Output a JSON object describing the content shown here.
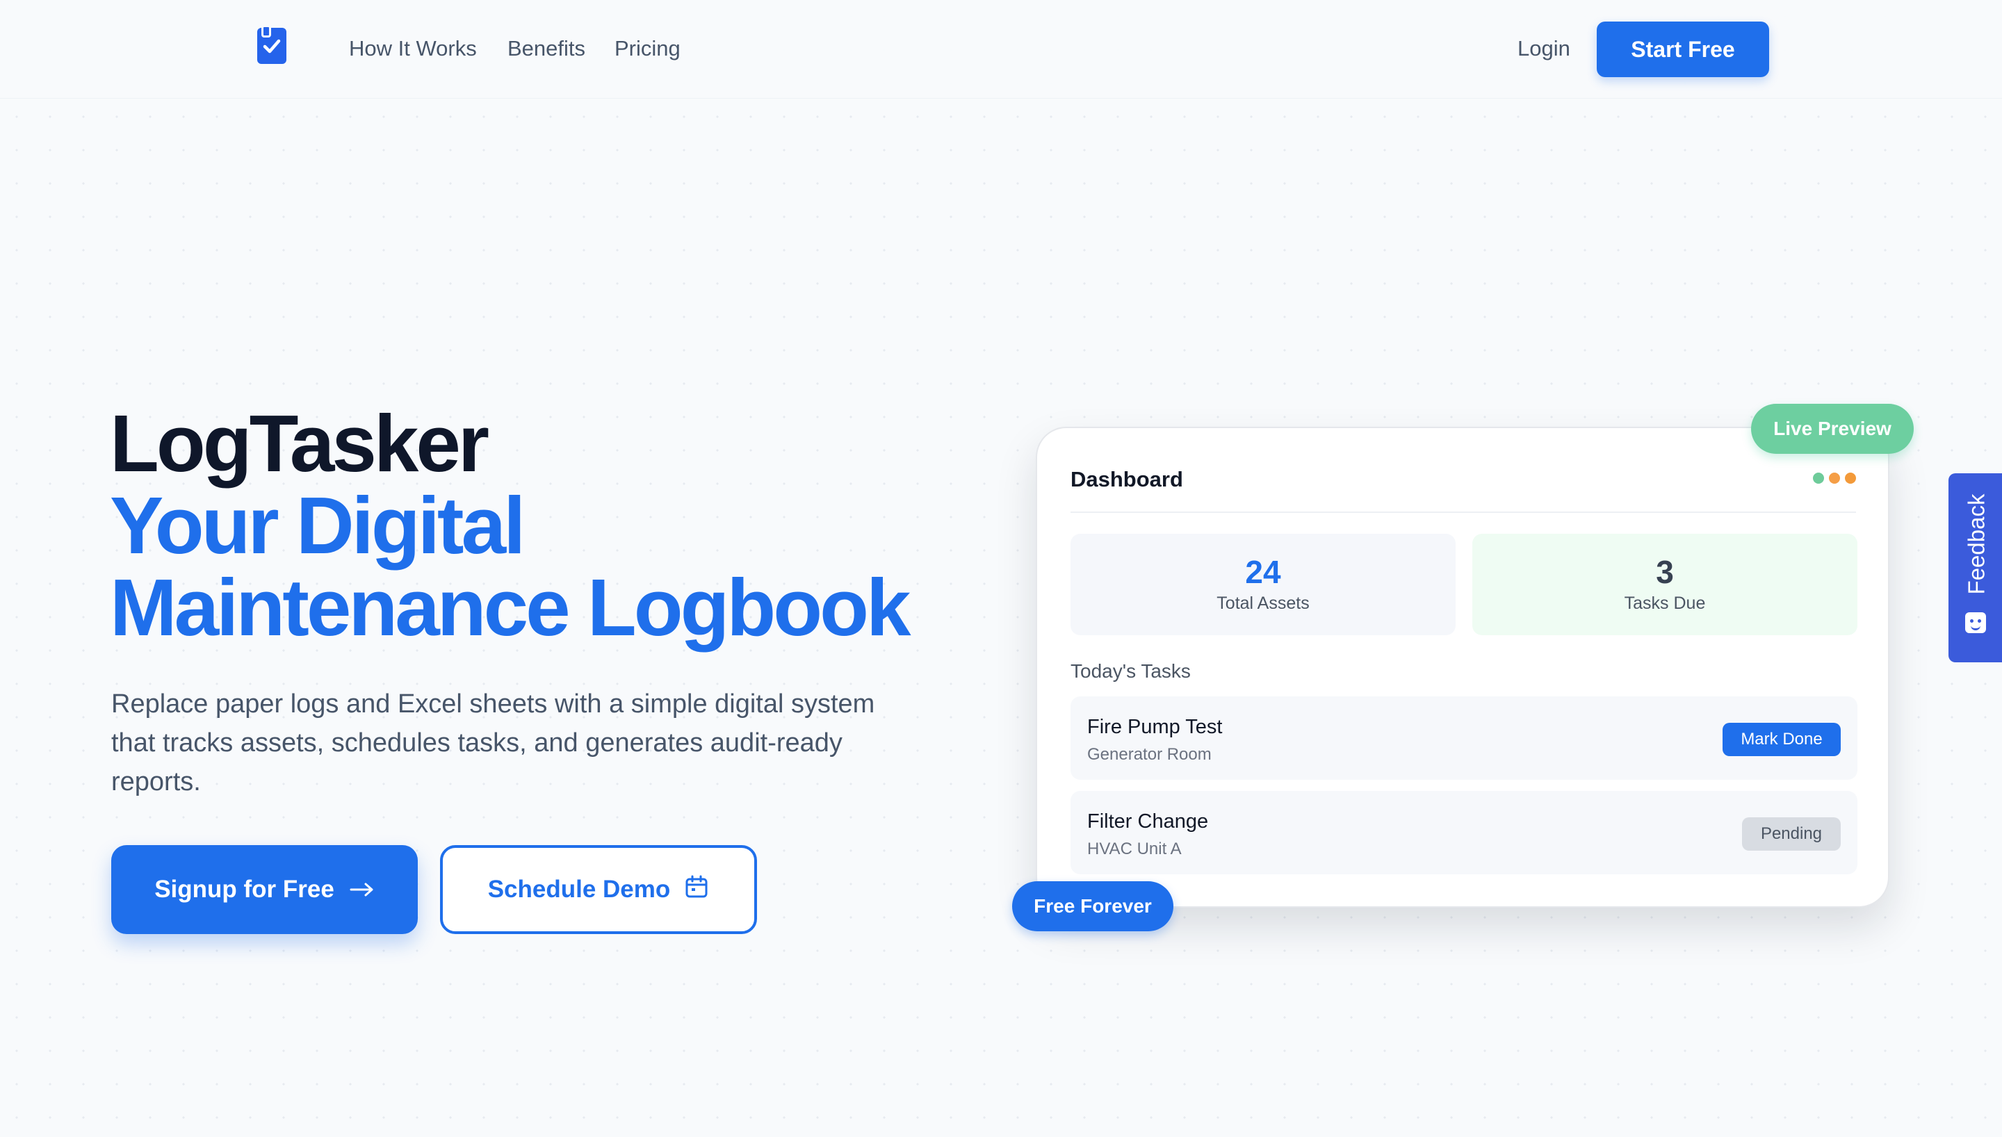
{
  "nav": {
    "links": [
      "How It Works",
      "Benefits",
      "Pricing"
    ],
    "login_label": "Login",
    "cta_label": "Start Free"
  },
  "hero": {
    "brand": "LogTasker",
    "headline_line1": "Your Digital",
    "headline_line2": "Maintenance Logbook",
    "subtitle": "Replace paper logs and Excel sheets with a simple digital system that tracks assets, schedules tasks, and generates audit-ready reports.",
    "primary_cta": "Signup for Free",
    "secondary_cta": "Schedule Demo"
  },
  "dashboard": {
    "title": "Dashboard",
    "stats": [
      {
        "value": "24",
        "label": "Total Assets"
      },
      {
        "value": "3",
        "label": "Tasks Due"
      }
    ],
    "section_label": "Today's Tasks",
    "tasks": [
      {
        "name": "Fire Pump Test",
        "location": "Generator Room",
        "action": "Mark Done"
      },
      {
        "name": "Filter Change",
        "location": "HVAC Unit A",
        "status": "Pending"
      }
    ],
    "live_badge": "Live Preview",
    "free_badge": "Free Forever"
  },
  "feedback": {
    "label": "Feedback"
  },
  "colors": {
    "accent": "#1f6feb",
    "heading_dark": "#0f172a",
    "success": "#6dcfa0",
    "feedback_bg": "#3b5bdb"
  },
  "icons": {
    "logo": "clipboard-check-icon",
    "signup": "arrow-right-icon",
    "demo": "calendar-icon",
    "feedback": "smile-icon"
  }
}
